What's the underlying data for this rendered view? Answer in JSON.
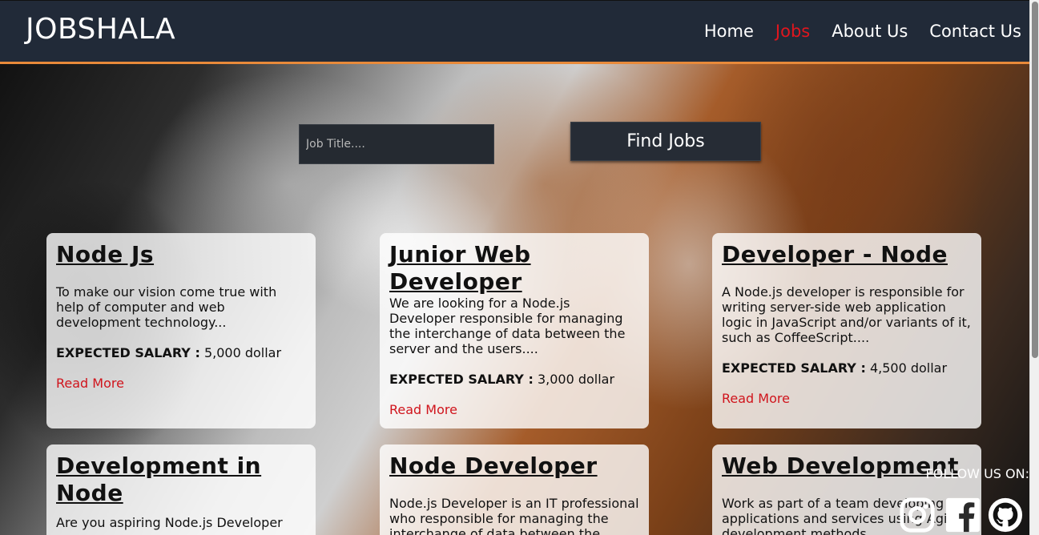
{
  "header": {
    "brand": "JOBSHALA",
    "nav": [
      {
        "label": "Home"
      },
      {
        "label": "Jobs"
      },
      {
        "label": "About Us"
      },
      {
        "label": "Contact Us"
      }
    ]
  },
  "search": {
    "placeholder": "Job Title....",
    "button_label": "Find Jobs"
  },
  "cards": [
    {
      "title": "Node Js",
      "desc": "To make our vision come true with help of computer and web development technology...",
      "salary_label": "EXPECTED SALARY :",
      "salary_value": "5,000 dollar",
      "link": "Read More"
    },
    {
      "title": "Junior Web Developer",
      "desc": "We are looking for a Node.js Developer responsible for managing the interchange of data between the server and the users....",
      "salary_label": "EXPECTED SALARY :",
      "salary_value": "3,000 dollar",
      "link": "Read More"
    },
    {
      "title": "Developer - Node",
      "desc": "A Node.js developer is responsible for writing server-side web application logic in JavaScript and/or variants of it, such as CoffeeScript....",
      "salary_label": "EXPECTED SALARY :",
      "salary_value": "4,500 dollar",
      "link": "Read More"
    },
    {
      "title": "Development in Node",
      "desc": "Are you aspiring Node.js Developer"
    },
    {
      "title": "Node Developer",
      "desc": "Node.js Developer is an IT professional who responsible for managing the interchange of data between the"
    },
    {
      "title": "Web Development",
      "desc": "Work as part of a team developing applications and services using Agile development methods"
    }
  ],
  "footer": {
    "follow_label": "FOLLOW US ON:",
    "icons": [
      "instagram-icon",
      "facebook-icon",
      "github-icon"
    ]
  },
  "colors": {
    "navbar": "#212a38",
    "accent": "#e88a3a",
    "active_nav": "#e0161e",
    "read_more": "#d0141c"
  }
}
